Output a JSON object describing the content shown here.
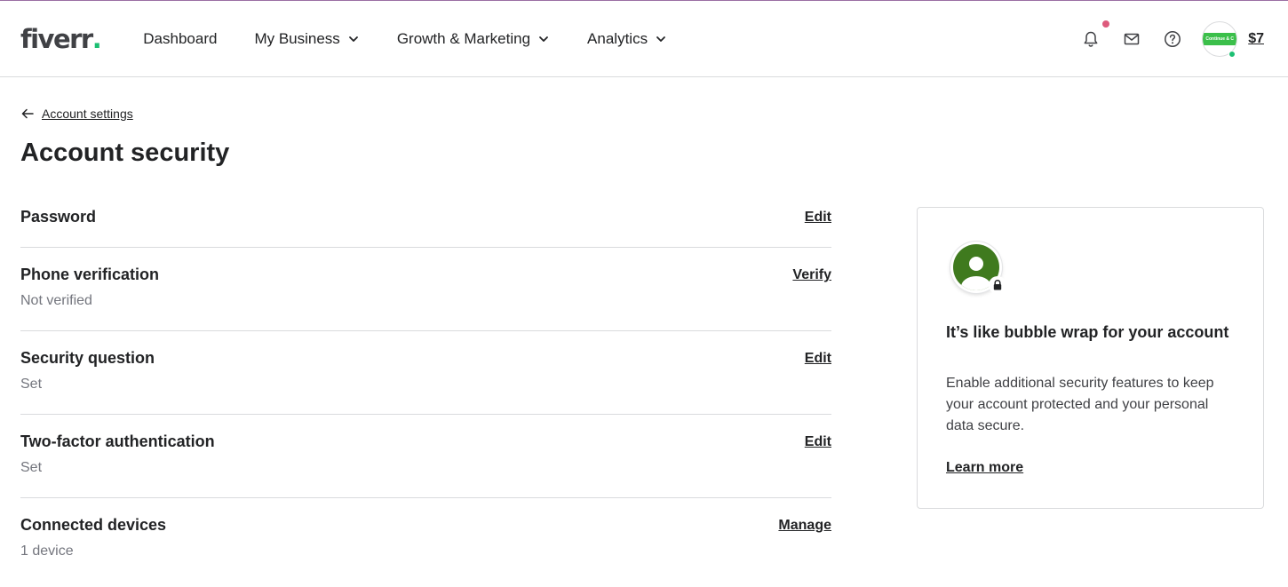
{
  "brand": {
    "logo_text": "fiverr",
    "logo_dot": "."
  },
  "nav": {
    "items": [
      {
        "label": "Dashboard",
        "has_dropdown": false
      },
      {
        "label": "My Business",
        "has_dropdown": true
      },
      {
        "label": "Growth & Marketing",
        "has_dropdown": true
      },
      {
        "label": "Analytics",
        "has_dropdown": true
      }
    ]
  },
  "header_tools": {
    "icons": [
      "bell-icon",
      "mail-icon",
      "help-icon"
    ],
    "avatar_text": "Continue & C",
    "balance": "$7"
  },
  "breadcrumb": {
    "back_label": "Account settings"
  },
  "page": {
    "title": "Account security"
  },
  "settings": [
    {
      "title": "Password",
      "subtitle": "",
      "action": "Edit"
    },
    {
      "title": "Phone verification",
      "subtitle": "Not verified",
      "action": "Verify"
    },
    {
      "title": "Security question",
      "subtitle": "Set",
      "action": "Edit"
    },
    {
      "title": "Two-factor authentication",
      "subtitle": "Set",
      "action": "Edit"
    },
    {
      "title": "Connected devices",
      "subtitle": "1 device",
      "action": "Manage"
    }
  ],
  "promo_card": {
    "title": "It’s like bubble wrap for your account",
    "text": "Enable additional security features to keep your account protected and your personal data secure.",
    "link": "Learn more"
  },
  "colors": {
    "brand_green": "#1dbf73",
    "notification": "#dd5a7c",
    "text": "#222325",
    "muted": "#74767e",
    "border": "#dadbdd"
  }
}
